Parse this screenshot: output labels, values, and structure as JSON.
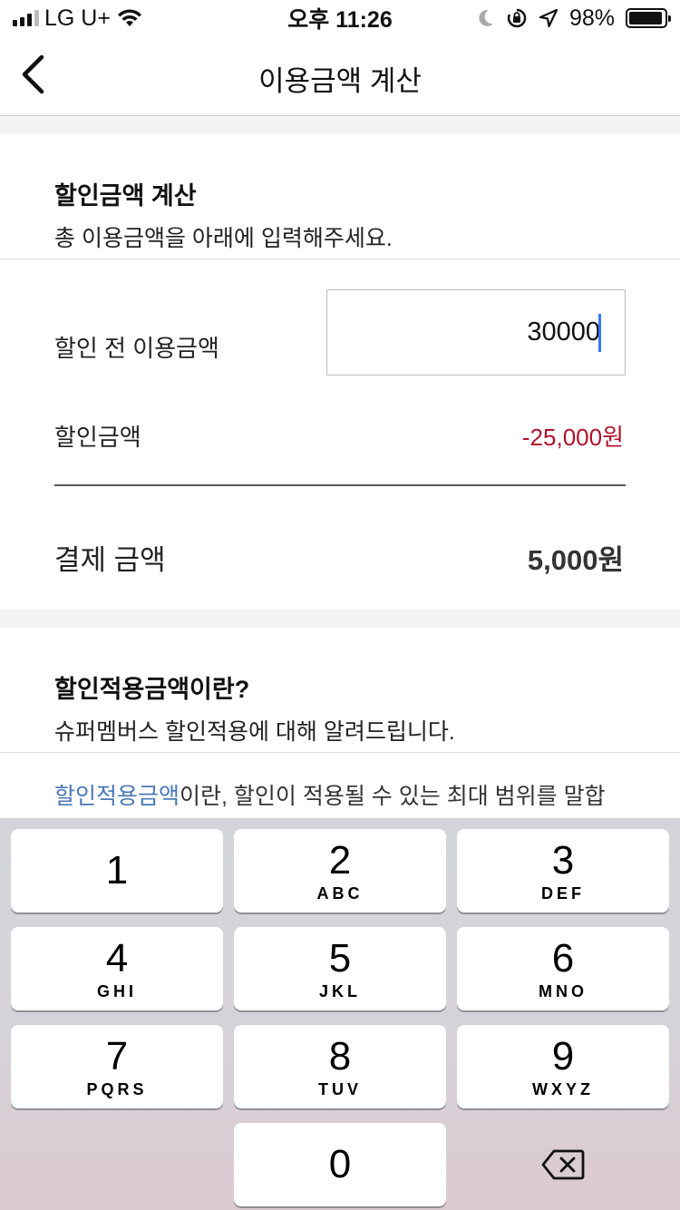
{
  "status_bar": {
    "carrier": "LG U+",
    "time": "오후 11:26",
    "battery": "98%",
    "battery_level": 0.98
  },
  "header": {
    "title": "이용금액 계산"
  },
  "calc": {
    "title": "할인금액 계산",
    "subtitle": "총 이용금액을 아래에 입력해주세요.",
    "before_label": "할인 전 이용금액",
    "input_value": "30000",
    "discount_label": "할인금액",
    "discount_value": "-25,000원",
    "pay_label": "결제 금액",
    "pay_value": "5,000원"
  },
  "info": {
    "title": "할인적용금액이란?",
    "subtitle": "슈퍼멤버스 할인적용에 대해 알려드립니다.",
    "highlight": "할인적용금액",
    "text_rest": "이란, 할인이 적용될 수 있는 최대 범위를 말합"
  },
  "keyboard": {
    "keys": [
      {
        "num": "1",
        "letters": ""
      },
      {
        "num": "2",
        "letters": "ABC"
      },
      {
        "num": "3",
        "letters": "DEF"
      },
      {
        "num": "4",
        "letters": "GHI"
      },
      {
        "num": "5",
        "letters": "JKL"
      },
      {
        "num": "6",
        "letters": "MNO"
      },
      {
        "num": "7",
        "letters": "PQRS"
      },
      {
        "num": "8",
        "letters": "TUV"
      },
      {
        "num": "9",
        "letters": "WXYZ"
      },
      {
        "num": "0",
        "letters": ""
      }
    ],
    "delete_icon": "backspace-icon"
  },
  "colors": {
    "discount": "#b0132b",
    "link": "#4a78b8",
    "caret": "#3478f6"
  }
}
